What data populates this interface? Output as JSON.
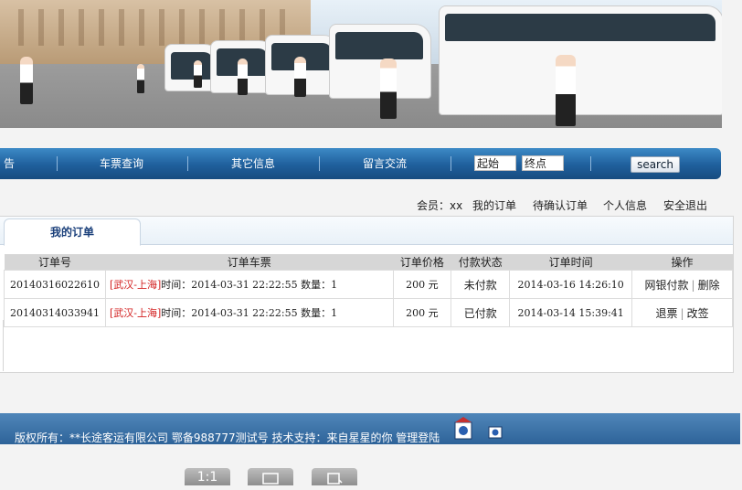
{
  "nav": {
    "items": [
      "告",
      "车票查询",
      "其它信息",
      "留言交流"
    ],
    "from_value": "起始",
    "to_value": "终点",
    "search_label": "search"
  },
  "userbar": {
    "member_label": "会员：xx",
    "my_orders": "我的订单",
    "pending": "待确认订单",
    "profile": "个人信息",
    "logout": "安全退出"
  },
  "tab": {
    "label": "我的订单"
  },
  "table": {
    "headers": [
      "订单号",
      "订单车票",
      "订单价格",
      "付款状态",
      "订单时间",
      "操作"
    ],
    "rows": [
      {
        "order_no": "20140316022610",
        "route": "[武汉-上海]",
        "detail": "时间：2014-03-31 22:22:55 数量：1",
        "price": "200 元",
        "status": "未付款",
        "time": "2014-03-16 14:26:10",
        "action1": "网银付款",
        "action2": "删除"
      },
      {
        "order_no": "20140314033941",
        "route": "[武汉-上海]",
        "detail": "时间：2014-03-31 22:22:55 数量：1",
        "price": "200 元",
        "status": "已付款",
        "time": "2014-03-14 15:39:41",
        "action1": "退票",
        "action2": "改签"
      }
    ]
  },
  "footer": {
    "text": "版权所有：**长途客运有限公司   鄂备988777测试号  技术支持：来自星星的你   管理登陆"
  },
  "bottom_buttons": [
    "1:1",
    "▢",
    "▢"
  ]
}
